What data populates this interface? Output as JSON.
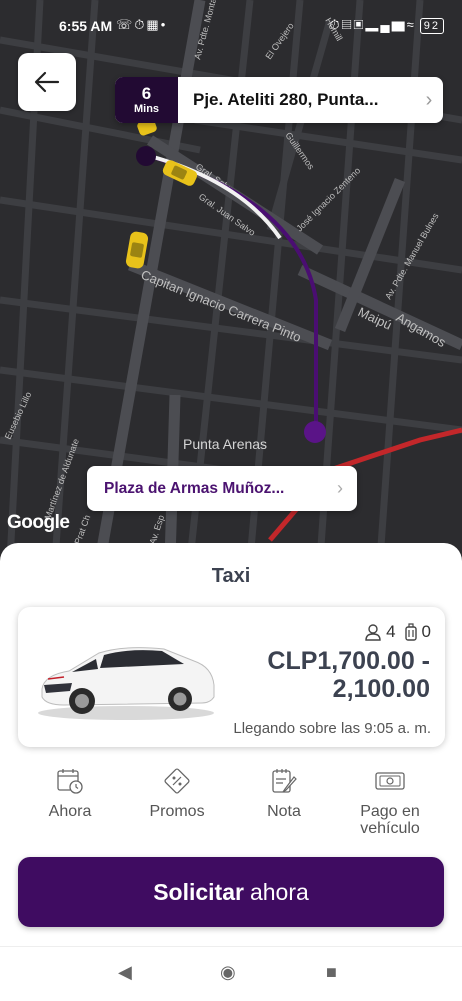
{
  "status_bar": {
    "time": "6:55 AM",
    "left_icons": [
      "whatsapp-icon",
      "alarm-icon",
      "teams-icon",
      "dot"
    ],
    "right_icons": [
      "alarm-icon",
      "vibrate-icon",
      "sim-icon",
      "signal-icon",
      "wifi-icon"
    ],
    "battery": "92"
  },
  "map": {
    "streets": [
      "Av. Pdte. Montalva",
      "El Ovejero",
      "Guillermos",
      "Gral. Salvo",
      "Gral. Juan Salvo",
      "José Ignacio Zenteno",
      "Capitan Ignacio Carrera Pinto",
      "Maipú",
      "Angamos",
      "Av. Pdte. Manuel Bulnes",
      "Eusebio Lillo",
      "Martínez de Aldunate",
      "Prat Ch",
      "Av. Esp",
      "Homill"
    ],
    "city_label": "Punta Arenas",
    "attribution": "Google",
    "route_color": "#4a0e72"
  },
  "origin": {
    "eta_value": "6",
    "eta_unit": "Mins",
    "address": "Pje. Ateliti 280, Punta..."
  },
  "destination": {
    "address": "Plaza de Armas Muñoz..."
  },
  "sheet": {
    "title": "Taxi",
    "passengers": "4",
    "luggage": "0",
    "price": "CLP1,700.00 - 2,100.00",
    "price_line1": "CLP1,700.00 -",
    "price_line2": "2,100.00",
    "arrival": "Llegando sobre las 9:05 a. m."
  },
  "actions": [
    {
      "label": "Ahora",
      "icon": "calendar-clock-icon"
    },
    {
      "label": "Promos",
      "icon": "promo-tag-icon"
    },
    {
      "label": "Nota",
      "icon": "note-edit-icon"
    },
    {
      "label": "Pago en vehículo",
      "line1": "Pago en",
      "line2": "vehículo",
      "icon": "cash-icon"
    }
  ],
  "request_button": {
    "bold": "Solicitar",
    "normal": "ahora",
    "color": "#3f0c61"
  },
  "nav": {
    "back": "back-triangle-icon",
    "home": "home-circle-icon",
    "recents": "recents-square-icon"
  }
}
